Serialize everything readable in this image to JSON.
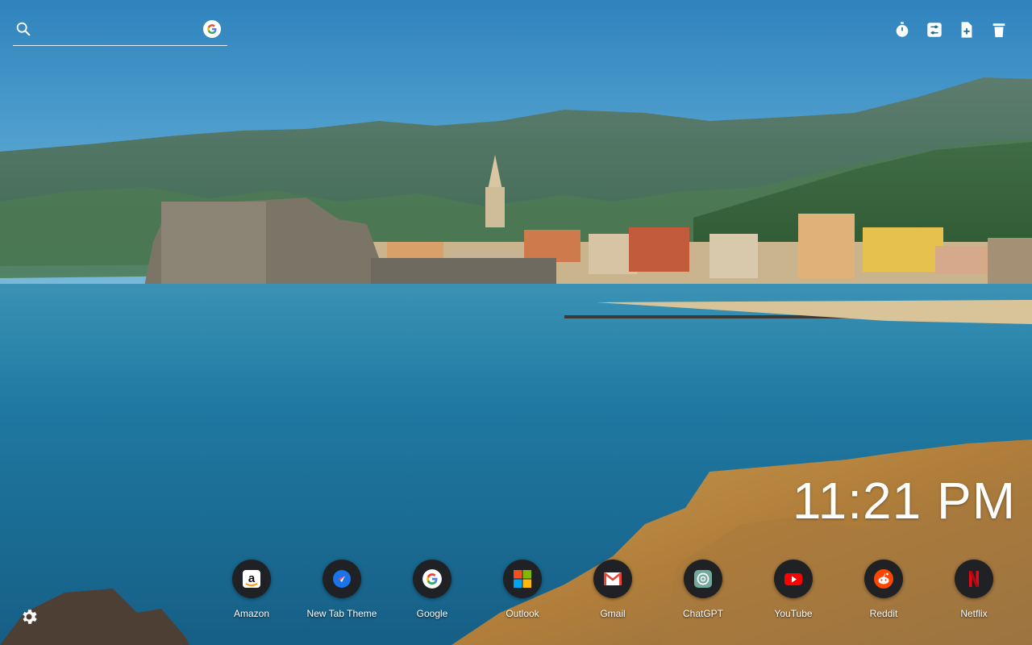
{
  "search": {
    "placeholder": "",
    "value": ""
  },
  "toolbar": {
    "items": [
      {
        "name": "timer-icon"
      },
      {
        "name": "sliders-icon"
      },
      {
        "name": "add-file-icon"
      },
      {
        "name": "trash-icon"
      }
    ]
  },
  "clock": {
    "time": "11:21 PM"
  },
  "shortcuts": [
    {
      "label": "Amazon",
      "icon": "amazon-icon"
    },
    {
      "label": "New Tab Theme",
      "icon": "compass-icon"
    },
    {
      "label": "Google",
      "icon": "google-icon"
    },
    {
      "label": "Outlook",
      "icon": "microsoft-icon"
    },
    {
      "label": "Gmail",
      "icon": "gmail-icon"
    },
    {
      "label": "ChatGPT",
      "icon": "chatgpt-icon"
    },
    {
      "label": "YouTube",
      "icon": "youtube-icon"
    },
    {
      "label": "Reddit",
      "icon": "reddit-icon"
    },
    {
      "label": "Netflix",
      "icon": "netflix-icon"
    }
  ],
  "colors": {
    "sky": "#3c8fc6",
    "sea": "#1f6f93",
    "shortcut_bg": "#202124"
  }
}
